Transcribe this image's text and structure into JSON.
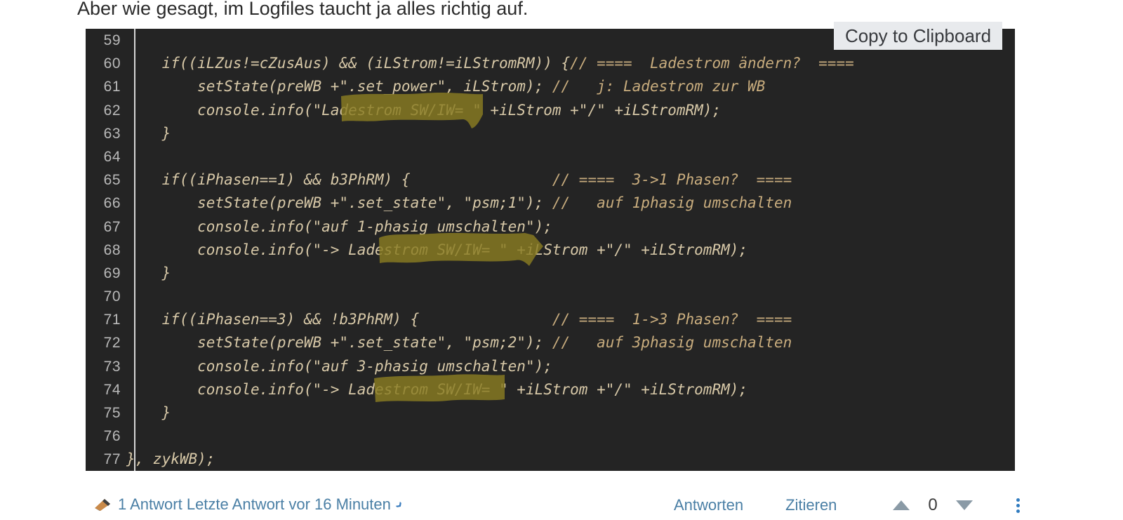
{
  "post": {
    "intro_text": "Aber wie gesagt, im Logfiles taucht ja alles richtig auf."
  },
  "code_block": {
    "copy_button_label": "Copy to Clipboard",
    "language": "javascript",
    "theme_background": "#242424",
    "code_color": "#d8c9a8",
    "comment_color": "#c9ad7e",
    "line_number_color": "#b9b9b9",
    "highlight_color": "#8a7d22",
    "lines": [
      {
        "number": "59",
        "code": "",
        "comment": ""
      },
      {
        "number": "60",
        "code": "    if((iLZus!=cZusAus) && (iLStrom!=iLStromRM)) {",
        "comment": "// ====  Ladestrom ändern?  ===="
      },
      {
        "number": "61",
        "code": "        setState(preWB +\".set_power\", iLStrom);",
        "comment": "//   j: Ladestrom zur WB"
      },
      {
        "number": "62",
        "code": "        console.info(\"Ladestrom SW/IW= \" +iLStrom +\"/\" +iLStromRM);",
        "comment": ""
      },
      {
        "number": "63",
        "code": "    }",
        "comment": ""
      },
      {
        "number": "64",
        "code": "",
        "comment": ""
      },
      {
        "number": "65",
        "code": "    if((iPhasen==1) && b3PhRM) {",
        "comment": "// ====  3->1 Phasen?  ===="
      },
      {
        "number": "66",
        "code": "        setState(preWB +\".set_state\", \"psm;1\");",
        "comment": "//   auf 1phasig umschalten"
      },
      {
        "number": "67",
        "code": "        console.info(\"auf 1-phasig umschalten\");",
        "comment": ""
      },
      {
        "number": "68",
        "code": "        console.info(\"-> Ladestrom SW/IW= \" +iLStrom +\"/\" +iLStromRM);",
        "comment": ""
      },
      {
        "number": "69",
        "code": "    }",
        "comment": ""
      },
      {
        "number": "70",
        "code": "",
        "comment": ""
      },
      {
        "number": "71",
        "code": "    if((iPhasen==3) && !b3PhRM) {",
        "comment": "// ====  1->3 Phasen?  ===="
      },
      {
        "number": "72",
        "code": "        setState(preWB +\".set_state\", \"psm;2\");",
        "comment": "//   auf 3phasig umschalten"
      },
      {
        "number": "73",
        "code": "        console.info(\"auf 3-phasig umschalten\");",
        "comment": ""
      },
      {
        "number": "74",
        "code": "        console.info(\"-> Ladestrom SW/IW= \" +iLStrom +\"/\" +iLStromRM);",
        "comment": ""
      },
      {
        "number": "75",
        "code": "    }",
        "comment": ""
      },
      {
        "number": "76",
        "code": "",
        "comment": ""
      },
      {
        "number": "77",
        "code": "}, zykWB);",
        "comment": ""
      }
    ]
  },
  "footer": {
    "replies_label": "1 Antwort Letzte Antwort vor 16 Minuten",
    "reply_action_label": "Antworten",
    "quote_action_label": "Zitieren",
    "vote_count": "0",
    "link_color": "#4a7fa5"
  }
}
